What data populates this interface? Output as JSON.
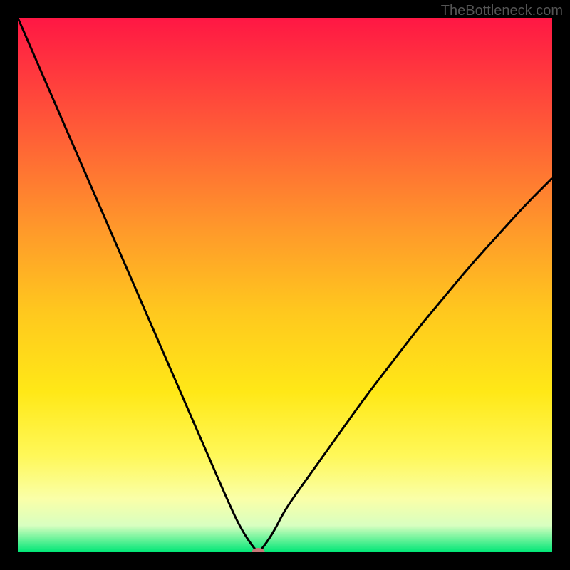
{
  "watermark": "TheBottleneck.com",
  "chart_data": {
    "type": "line",
    "title": "",
    "xlabel": "",
    "ylabel": "",
    "xlim": [
      0,
      100
    ],
    "ylim": [
      0,
      100
    ],
    "x": [
      0,
      5,
      10,
      15,
      20,
      25,
      30,
      35,
      40,
      42,
      44,
      45,
      46,
      48,
      50,
      55,
      60,
      65,
      70,
      75,
      80,
      85,
      90,
      95,
      100
    ],
    "y": [
      100,
      88.5,
      77,
      65.5,
      54,
      42.5,
      31,
      19.5,
      8,
      4,
      1,
      0,
      1,
      4,
      8,
      15,
      22,
      29,
      35.5,
      42,
      48,
      54,
      59.5,
      65,
      70
    ],
    "minimum_marker": {
      "x": 45,
      "y": 0,
      "color": "#c87878"
    },
    "gradient_stops": [
      {
        "offset": 0,
        "color": "#ff1744"
      },
      {
        "offset": 20,
        "color": "#ff5838"
      },
      {
        "offset": 40,
        "color": "#ff9a2a"
      },
      {
        "offset": 55,
        "color": "#ffc81e"
      },
      {
        "offset": 70,
        "color": "#ffe817"
      },
      {
        "offset": 82,
        "color": "#fff859"
      },
      {
        "offset": 90,
        "color": "#faffa8"
      },
      {
        "offset": 95,
        "color": "#d8ffc0"
      },
      {
        "offset": 100,
        "color": "#00e676"
      }
    ]
  }
}
